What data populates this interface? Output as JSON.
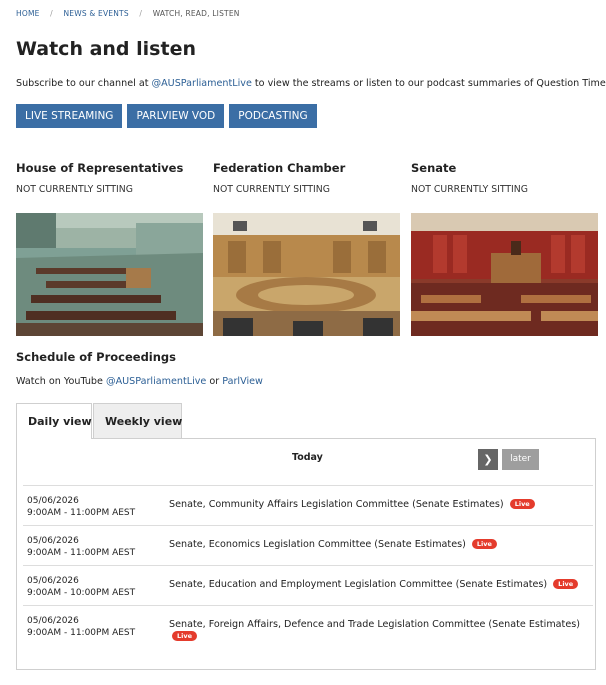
{
  "breadcrumb": {
    "home": "HOME",
    "section": "NEWS & EVENTS",
    "current": "WATCH, READ, LISTEN"
  },
  "page_title": "Watch and listen",
  "intro": {
    "before": "Subscribe to our channel at ",
    "link": "@AUSParliamentLive",
    "after": " to view the streams or listen to our podcast summaries of Question Time!"
  },
  "buttons": {
    "live_streaming": "LIVE STREAMING",
    "parlview_vod": "PARLVIEW VOD",
    "podcasting": "PODCASTING"
  },
  "chambers": [
    {
      "name": "House of Representatives",
      "status": "NOT CURRENTLY SITTING"
    },
    {
      "name": "Federation Chamber",
      "status": "NOT CURRENTLY SITTING"
    },
    {
      "name": "Senate",
      "status": "NOT CURRENTLY SITTING"
    }
  ],
  "schedule": {
    "title": "Schedule of Proceedings",
    "watch_before": "Watch on YouTube ",
    "youtube_link": "@AUSParliamentLive",
    "watch_middle": " or ",
    "parlview_link": "ParlView",
    "tabs": {
      "daily": "Daily view",
      "weekly": "Weekly view"
    },
    "day_label": "Today",
    "later_label": "later",
    "live_label": "Live",
    "rows": [
      {
        "date": "05/06/2026",
        "time": "9:00AM - 11:00PM AEST",
        "title": "Senate, Community Affairs Legislation Committee (Senate Estimates)"
      },
      {
        "date": "05/06/2026",
        "time": "9:00AM - 11:00PM AEST",
        "title": "Senate, Economics Legislation Committee (Senate Estimates)"
      },
      {
        "date": "05/06/2026",
        "time": "9:00AM - 10:00PM AEST",
        "title": "Senate, Education and Employment Legislation Committee (Senate Estimates)"
      },
      {
        "date": "05/06/2026",
        "time": "9:00AM - 11:00PM AEST",
        "title": "Senate, Foreign Affairs, Defence and Trade Legislation Committee (Senate Estimates)"
      }
    ]
  },
  "colors": {
    "link": "#2c5f95",
    "button": "#3b6ea5",
    "live_badge": "#e43b2c",
    "later_button": "#9e9e9e",
    "arrow_button": "#666666"
  }
}
